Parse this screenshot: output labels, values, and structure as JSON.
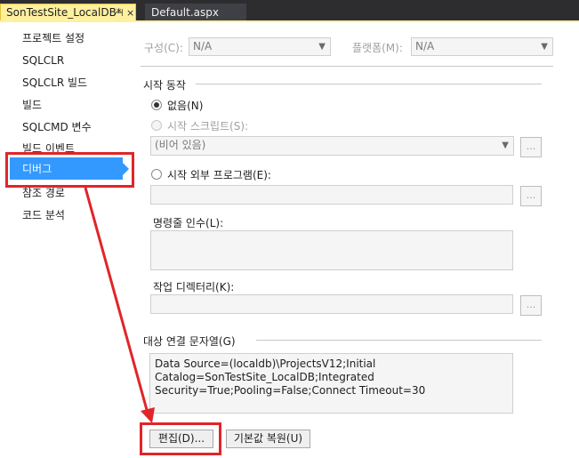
{
  "tabs": {
    "active": "SonTestSite_LocalDB*",
    "active_pin": "⊣",
    "active_close": "×",
    "inactive": "Default.aspx"
  },
  "sidebar": {
    "items": [
      "프로젝트 설정",
      "SQLCLR",
      "SQLCLR 빌드",
      "빌드",
      "SQLCMD 변수",
      "빌드 이벤트",
      "디버그",
      "참조 경로",
      "코드 분석"
    ],
    "selected": "디버그"
  },
  "config": {
    "label": "구성(C):",
    "value": "N/A",
    "platform_label": "플랫폼(M):",
    "platform_value": "N/A"
  },
  "start_action": {
    "heading": "시작 동작",
    "none_label": "없음(N)",
    "script_label": "시작 스크립트(S):",
    "script_value": "(비어 있음)",
    "external_label": "시작 외부 프로그램(E):",
    "args_label": "명령줄 인수(L):",
    "workdir_label": "작업 디렉터리(K):",
    "browse": "..."
  },
  "connection": {
    "heading": "대상 연결 문자열(G)",
    "lines": [
      "Data Source=(localdb)\\ProjectsV12;Initial",
      "Catalog=SonTestSite_LocalDB;Integrated",
      "Security=True;Pooling=False;Connect Timeout=30"
    ],
    "edit_button": "편집(D)...",
    "reset_button": "기본값 복원(U)"
  },
  "colors": {
    "accent_tab": "#fff0a0",
    "selection": "#3399ff",
    "annotation": "#e0252a"
  }
}
